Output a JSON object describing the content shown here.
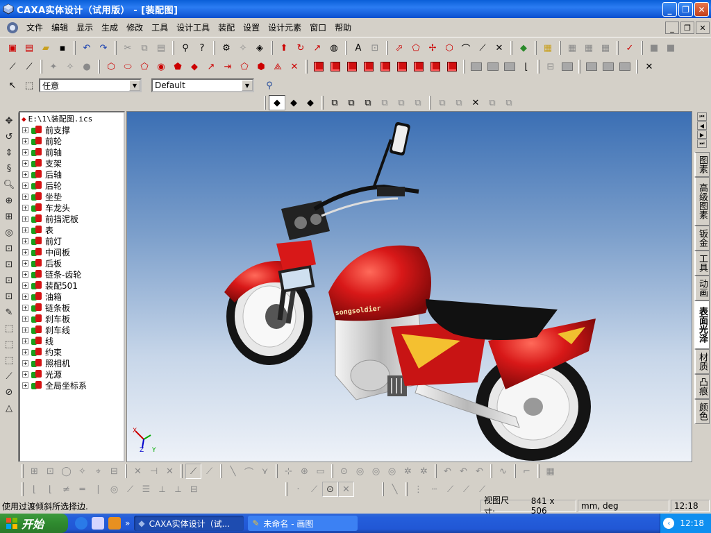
{
  "window": {
    "title": "CAXA实体设计（试用版） - [装配图]",
    "buttons": [
      "_",
      "❐",
      "✕"
    ]
  },
  "menu": {
    "items": [
      "文件",
      "编辑",
      "显示",
      "生成",
      "修改",
      "工具",
      "设计工具",
      "装配",
      "设置",
      "设计元素",
      "窗口",
      "帮助"
    ]
  },
  "selectors": {
    "filter": "任意",
    "style": "Default"
  },
  "tree": {
    "root": "E:\\1\\装配图.ics",
    "items": [
      "前支撑",
      "前轮",
      "前轴",
      "支架",
      "后轴",
      "后轮",
      "坐垫",
      "车龙头",
      "前挡泥板",
      "表",
      "前灯",
      "中间板",
      "后板",
      "链条-齿轮",
      "装配501",
      "油箱",
      "链条板",
      "刹车板",
      "刹车线",
      "线",
      "约束",
      "照相机",
      "光源",
      "全局坐标系"
    ]
  },
  "viewport": {
    "tank_text": "songsoldier",
    "axes": {
      "x": "X",
      "y": "Y",
      "z": "Z"
    }
  },
  "right_tabs": [
    "图素",
    "高级图素",
    "钣金",
    "工具",
    "动画",
    "表面光泽",
    "材质",
    "凸痕",
    "颜色"
  ],
  "right_tabs_active": "表面光泽",
  "status": {
    "message": "使用过渡倾斜所选择边.",
    "view_size_label": "视图尺寸:",
    "view_size_value": "841 x 506",
    "units": "mm, deg",
    "time": "12:18"
  },
  "taskbar": {
    "start": "开始",
    "tasks": [
      "CAXA实体设计（试...",
      "未命名 - 画图"
    ],
    "clock": "12:18"
  },
  "colors": {
    "title_blue": "#0a5fd8",
    "bike_red": "#d81818",
    "taskbar_blue": "#245edb",
    "start_green": "#3c9a3c"
  }
}
